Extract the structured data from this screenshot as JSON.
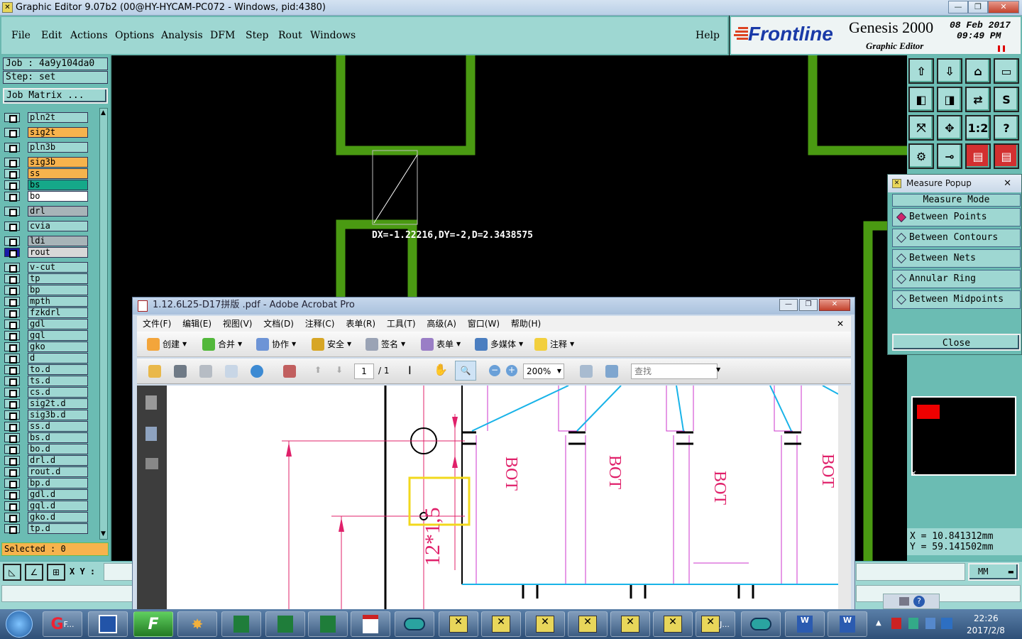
{
  "window": {
    "title": "Graphic Editor 9.07b2 (00@HY-HYCAM-PC072 - Windows, pid:4380)"
  },
  "menu": {
    "items": [
      "File",
      "Edit",
      "Actions",
      "Options",
      "Analysis",
      "DFM",
      "Step",
      "Rout",
      "Windows"
    ],
    "help": "Help"
  },
  "brand": {
    "logo": "Frontline",
    "product": "Genesis 2000",
    "subtitle": "Graphic Editor",
    "date": "08 Feb 2017",
    "time": "09:49  PM"
  },
  "job": {
    "job_label": "Job  : 4a9y104da0",
    "step_label": "Step: set",
    "matrix_button": "Job Matrix ..."
  },
  "layers": [
    {
      "name": "pln2t",
      "color": "#9ed7d2"
    },
    {
      "name": "sig2t",
      "color": "#f7b34d"
    },
    {
      "name": "pln3b",
      "color": "#9ed7d2"
    },
    {
      "name": "sig3b",
      "color": "#f7b34d"
    },
    {
      "name": "ss",
      "color": "#f7b34d"
    },
    {
      "name": "bs",
      "color": "#15a889"
    },
    {
      "name": "bo",
      "color": "#ffffff"
    },
    {
      "name": "drl",
      "color": "#a7b4b8"
    },
    {
      "name": "cvia",
      "color": "#9ed7d2"
    },
    {
      "name": "ldi",
      "color": "#a7b4b8"
    },
    {
      "name": "rout",
      "color": "#d8d8d8"
    },
    {
      "name": "v-cut",
      "color": "#9ed7d2"
    },
    {
      "name": "tp",
      "color": "#9ed7d2"
    },
    {
      "name": "bp",
      "color": "#9ed7d2"
    },
    {
      "name": "mpth",
      "color": "#9ed7d2"
    },
    {
      "name": "fzkdrl",
      "color": "#9ed7d2"
    },
    {
      "name": "gdl",
      "color": "#9ed7d2"
    },
    {
      "name": "gql",
      "color": "#9ed7d2"
    },
    {
      "name": "gko",
      "color": "#9ed7d2"
    },
    {
      "name": "d",
      "color": "#9ed7d2"
    },
    {
      "name": "to.d",
      "color": "#9ed7d2"
    },
    {
      "name": "ts.d",
      "color": "#9ed7d2"
    },
    {
      "name": "cs.d",
      "color": "#9ed7d2"
    },
    {
      "name": "sig2t.d",
      "color": "#9ed7d2"
    },
    {
      "name": "sig3b.d",
      "color": "#9ed7d2"
    },
    {
      "name": "ss.d",
      "color": "#9ed7d2"
    },
    {
      "name": "bs.d",
      "color": "#9ed7d2"
    },
    {
      "name": "bo.d",
      "color": "#9ed7d2"
    },
    {
      "name": "drl.d",
      "color": "#9ed7d2"
    },
    {
      "name": "rout.d",
      "color": "#9ed7d2"
    },
    {
      "name": "bp.d",
      "color": "#9ed7d2"
    },
    {
      "name": "gdl.d",
      "color": "#9ed7d2"
    },
    {
      "name": "gql.d",
      "color": "#9ed7d2"
    },
    {
      "name": "gko.d",
      "color": "#9ed7d2"
    },
    {
      "name": "tp.d",
      "color": "#9ed7d2"
    }
  ],
  "selected_label": "Selected : 0",
  "xy_label": "X Y :",
  "units": "MM",
  "measure_text": "DX=-1.22216,DY=-2,D=2.3438575",
  "measure_popup": {
    "title": "Measure Popup",
    "mode_label": "Measure Mode",
    "options": [
      "Between Points",
      "Between Contours",
      "Between Nets",
      "Annular Ring",
      "Between Midpoints"
    ],
    "selected_option": "Between Points",
    "close_label": "Close"
  },
  "coords": {
    "x": "X  =  10.841312mm",
    "y": "Y  =  59.141502mm"
  },
  "toolbar_icons": [
    "zoom-home-icon",
    "zoom-in-icon",
    "house-icon",
    "window-icon",
    "pan-left-icon",
    "pan-right-icon",
    "mirror-icon",
    "s-icon",
    "fit-icon",
    "center-icon",
    "ratio-1-2-icon",
    "help-icon",
    "tools-icon",
    "measure-icon",
    "layers-red-icon",
    "layers-red2-icon"
  ],
  "toolbar_labels": {
    "ratio": "1:2",
    "help": "?"
  },
  "acrobat": {
    "title": "1.12.6L25-D17拼版 .pdf - Adobe Acrobat Pro",
    "menu": [
      "文件(F)",
      "编辑(E)",
      "视图(V)",
      "文档(D)",
      "注释(C)",
      "表单(R)",
      "工具(T)",
      "高级(A)",
      "窗口(W)",
      "帮助(H)"
    ],
    "tools": [
      "创建",
      "合并",
      "协作",
      "安全",
      "签名",
      "表单",
      "多媒体",
      "注释"
    ],
    "page_current": "1",
    "page_total": "/ 1",
    "zoom": "200%",
    "find_placeholder": "查找",
    "doc_labels": [
      "BOT",
      "BOT",
      "BOT",
      "BOT"
    ],
    "dimension_text": "12*1,5"
  },
  "taskbar": {
    "time": "22:26",
    "date": "2017/2/8",
    "item_label_f": "F...",
    "item_label_j": "J..."
  }
}
